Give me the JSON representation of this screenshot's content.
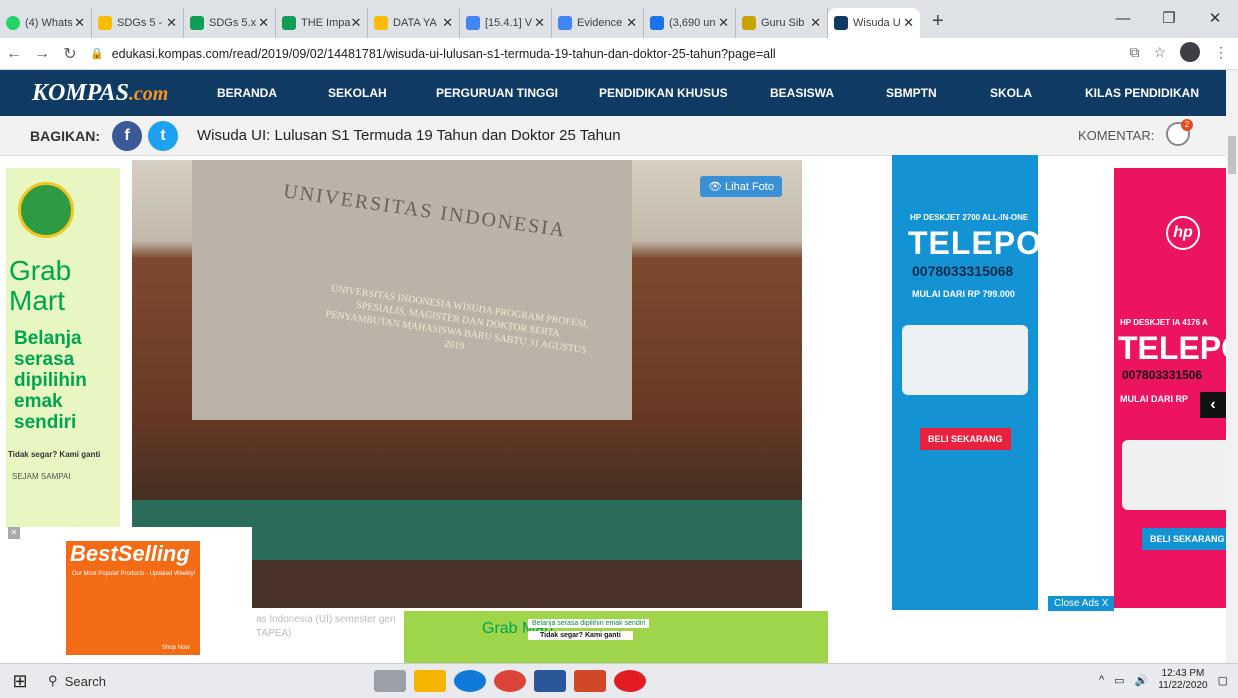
{
  "tabs": [
    {
      "title": "(4) Whats",
      "color": "#25d366"
    },
    {
      "title": "SDGs 5 -",
      "color": "#fbbc05"
    },
    {
      "title": "SDGs 5.x",
      "color": "#0f9d58"
    },
    {
      "title": "THE Impa",
      "color": "#0f9d58"
    },
    {
      "title": "DATA YA",
      "color": "#fbbc05"
    },
    {
      "title": "[15.4.1] V",
      "color": "#4285f4"
    },
    {
      "title": "Evidence",
      "color": "#4285f4"
    },
    {
      "title": "(3,690 un",
      "color": "#1a73e8"
    },
    {
      "title": "Guru Sib",
      "color": "#c9a400"
    },
    {
      "title": "Wisuda U",
      "color": "#0e3a64"
    }
  ],
  "address": {
    "url": "edukasi.kompas.com/read/2019/09/02/14481781/wisuda-ui-lulusan-s1-termuda-19-tahun-dan-doktor-25-tahun?page=all"
  },
  "nav": {
    "logo_main": "KOMPAS",
    "logo_suffix": ".com",
    "items": [
      "BERANDA",
      "SEKOLAH",
      "PERGURUAN TINGGI",
      "PENDIDIKAN KHUSUS",
      "BEASISWA",
      "SBMPTN",
      "SKOLA",
      "KILAS PENDIDIKAN"
    ]
  },
  "share": {
    "label": "BAGIKAN:",
    "title": "Wisuda UI: Lulusan S1 Termuda 19 Tahun dan Doktor 25 Tahun",
    "komentar": "KOMENTAR:",
    "comment_count": "2"
  },
  "photo": {
    "button": "Lihat Foto",
    "wall_text": "UNIVERSITAS INDONESIA",
    "banner": "UNIVERSITAS INDONESIA WISUDA PROGRAM PROFESI, SPESIALIS, MAGISTER DAN DOKTOR SERTA PENYAMBUTAN MAHASISWA BARU SABTU 31 AGUSTUS 2019",
    "caption1": "as Indonesia (UI) semester gen",
    "caption2": "TAPEA)"
  },
  "ad_grab_left": {
    "line1": "Grab",
    "line2": "Mart",
    "slogan": "Belanja serasa dipilihin emak sendiri",
    "tag": "Tidak segar? Kami ganti",
    "brand": "SEJAM SAMPAI"
  },
  "ad_hp_center": {
    "model": "HP DESKJET 2700 ALL-IN-ONE",
    "headline": "TELEPON",
    "phone": "0078033315068",
    "price": "MULAI DARI RP 799.000",
    "button": "BELI SEKARANG",
    "close": "Close Ads X"
  },
  "ad_hp_right": {
    "model": "HP DESKJET IA 4176 A",
    "headline": "TELEPO",
    "phone": "007803331506",
    "price": "MULAI DARI RP",
    "button": "BELI SEKARANG"
  },
  "ad_best": {
    "title": "BestSelling",
    "subtitle": "Our Most Popular Products - Updated Weekly!",
    "shop": "Shop Now"
  },
  "ad_grab_bottom": {
    "brand": "Grab Mart",
    "line1": "Belanja serasa dipilihin emak sendiri",
    "line2": "Tidak segar? Kami ganti"
  },
  "taskbar": {
    "search": "Search",
    "time": "12:43 PM",
    "date": "11/22/2020"
  }
}
